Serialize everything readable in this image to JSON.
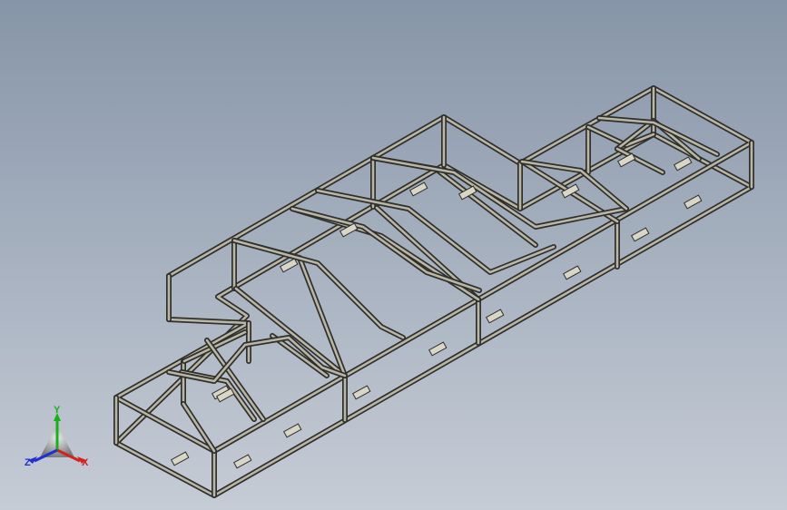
{
  "viewport": {
    "background_top": "#8795a8",
    "background_bottom": "#c6ccd6"
  },
  "model": {
    "description_icon": "frame-weldment-3d-model",
    "member_color": "#2f2f2c",
    "member_fill": "#b9b6a6",
    "plate_color": "#d9d6c8"
  },
  "triad": {
    "x_label": "X",
    "y_label": "Y",
    "z_label": "Z",
    "x_color": "#d42020",
    "y_color": "#18b018",
    "z_color": "#2030d0"
  }
}
